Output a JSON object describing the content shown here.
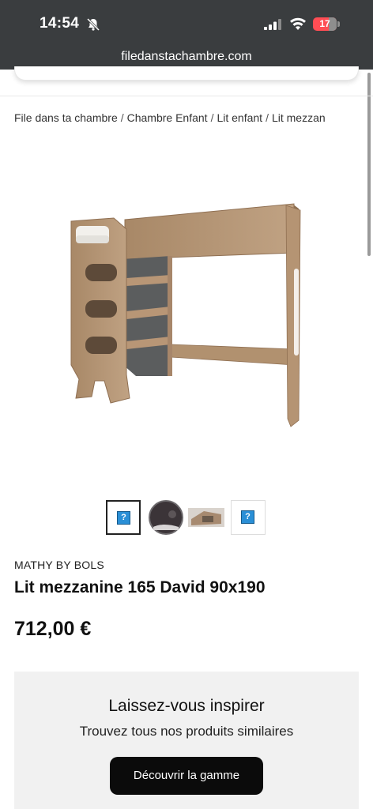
{
  "status_bar": {
    "time": "14:54",
    "battery": "17",
    "icons": [
      "bell-slash-icon",
      "signal-icon",
      "wifi-icon",
      "battery-icon"
    ]
  },
  "browser": {
    "url": "filedanstachambre.com"
  },
  "breadcrumb": [
    "File dans ta chambre",
    "Chambre Enfant",
    "Lit enfant",
    "Lit mezzan"
  ],
  "breadcrumb_separator": "/",
  "gallery": {
    "thumbnails": [
      {
        "kind": "broken-image",
        "glyph": "?"
      },
      {
        "kind": "photo-round-detail"
      },
      {
        "kind": "photo-bed-side"
      },
      {
        "kind": "broken-image",
        "glyph": "?"
      }
    ]
  },
  "product": {
    "brand": "MATHY BY BOLS",
    "title": "Lit mezzanine 165 David 90x190",
    "price": "712,00 €"
  },
  "inspire": {
    "title": "Laissez-vous inspirer",
    "subtitle": "Trouvez tous nos produits similaires",
    "button_label": "Découvrir la gamme"
  },
  "colors": {
    "status_bar_bg": "#3a3d3f",
    "battery_red": "#ff4d54",
    "button_bg": "#0b0b0b",
    "panel_bg": "#f1f1f1",
    "wood": "#b08f6e"
  }
}
